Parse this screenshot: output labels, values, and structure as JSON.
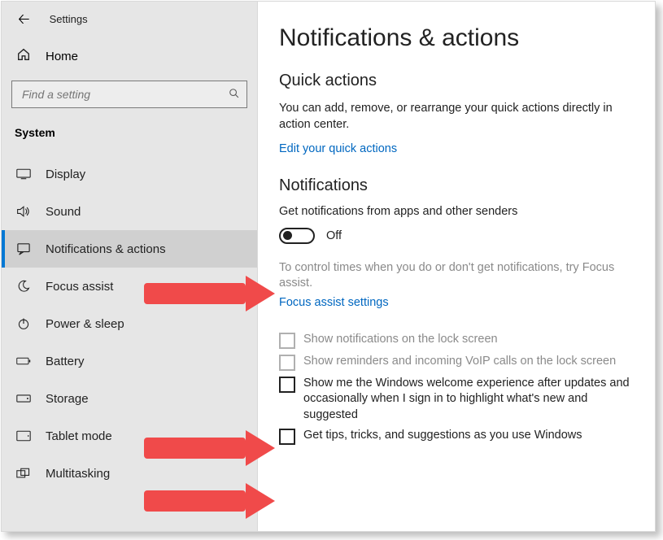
{
  "app": {
    "title": "Settings"
  },
  "sidebar": {
    "home": "Home",
    "searchPlaceholder": "Find a setting",
    "group": "System",
    "items": [
      {
        "label": "Display"
      },
      {
        "label": "Sound"
      },
      {
        "label": "Notifications & actions"
      },
      {
        "label": "Focus assist"
      },
      {
        "label": "Power & sleep"
      },
      {
        "label": "Battery"
      },
      {
        "label": "Storage"
      },
      {
        "label": "Tablet mode"
      },
      {
        "label": "Multitasking"
      }
    ]
  },
  "main": {
    "heading": "Notifications & actions",
    "quick": {
      "title": "Quick actions",
      "desc": "You can add, remove, or rearrange your quick actions directly in action center.",
      "link": "Edit your quick actions"
    },
    "notif": {
      "title": "Notifications",
      "getFrom": "Get notifications from apps and other senders",
      "toggleState": "Off",
      "help": "To control times when you do or don't get notifications, try Focus assist.",
      "focusLink": "Focus assist settings",
      "chk1": "Show notifications on the lock screen",
      "chk2": "Show reminders and incoming VoIP calls on the lock screen",
      "chk3": "Show me the Windows welcome experience after updates and occasionally when I sign in to highlight what's new and suggested",
      "chk4": "Get tips, tricks, and suggestions as you use Windows"
    }
  }
}
